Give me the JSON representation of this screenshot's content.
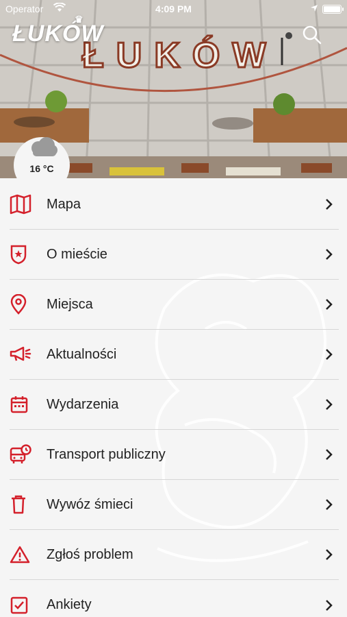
{
  "status_bar": {
    "carrier": "Operator",
    "time": "4:09 PM"
  },
  "header": {
    "logo": "ŁUKÓW",
    "sign_text": "ŁUKÓW"
  },
  "weather": {
    "temperature": "16 °C",
    "icon": "cloud-icon"
  },
  "colors": {
    "accent": "#d4202b",
    "text": "#222222",
    "divider": "#d6d6d6",
    "background": "#f5f5f5"
  },
  "menu": {
    "items": [
      {
        "label": "Mapa",
        "icon": "map-icon"
      },
      {
        "label": "O mieście",
        "icon": "crest-icon"
      },
      {
        "label": "Miejsca",
        "icon": "pin-icon"
      },
      {
        "label": "Aktualności",
        "icon": "megaphone-icon"
      },
      {
        "label": "Wydarzenia",
        "icon": "calendar-icon"
      },
      {
        "label": "Transport publiczny",
        "icon": "bus-icon"
      },
      {
        "label": "Wywóz śmieci",
        "icon": "trash-icon"
      },
      {
        "label": "Zgłoś problem",
        "icon": "warning-icon"
      },
      {
        "label": "Ankiety",
        "icon": "checkbox-icon"
      }
    ]
  }
}
